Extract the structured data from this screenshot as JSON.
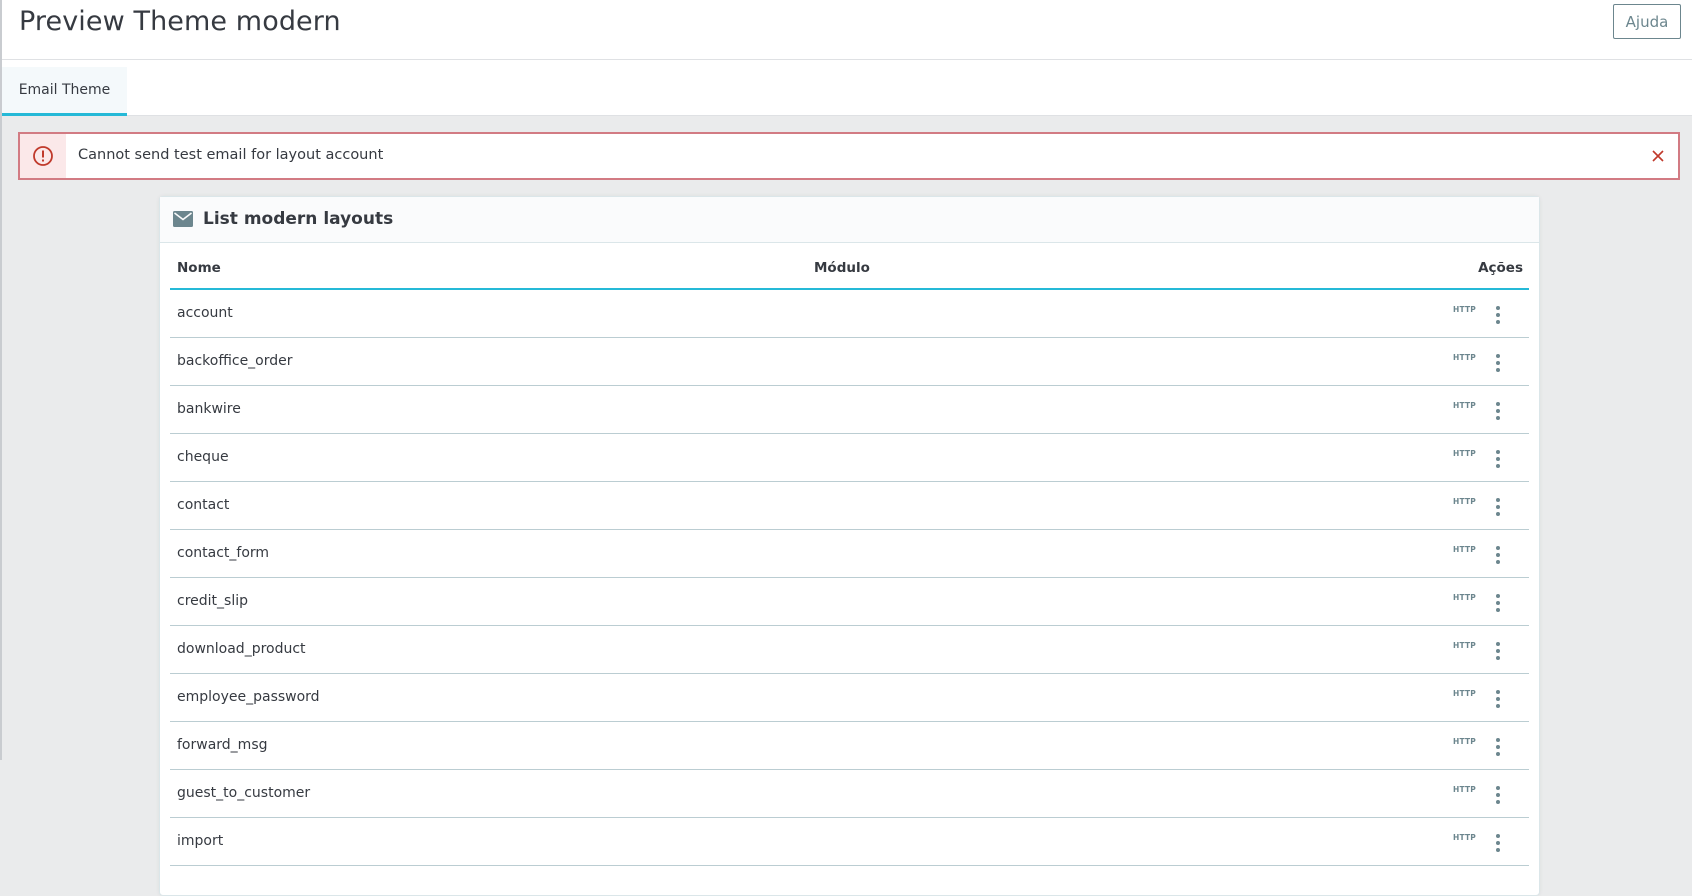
{
  "header": {
    "title": "Preview Theme modern",
    "help_label": "Ajuda"
  },
  "tabs": [
    {
      "label": "Email Theme",
      "active": true
    }
  ],
  "alert": {
    "message": "Cannot send test email for layout account",
    "icon": "error-circle-icon",
    "close_icon": "close-icon",
    "color": "#d27b83"
  },
  "card": {
    "icon": "envelope-icon",
    "title": "List modern layouts",
    "columns": {
      "name": "Nome",
      "module": "Módulo",
      "actions": "Ações"
    },
    "rows": [
      {
        "name": "account",
        "module": "",
        "action_badge": "HTTP"
      },
      {
        "name": "backoffice_order",
        "module": "",
        "action_badge": "HTTP"
      },
      {
        "name": "bankwire",
        "module": "",
        "action_badge": "HTTP"
      },
      {
        "name": "cheque",
        "module": "",
        "action_badge": "HTTP"
      },
      {
        "name": "contact",
        "module": "",
        "action_badge": "HTTP"
      },
      {
        "name": "contact_form",
        "module": "",
        "action_badge": "HTTP"
      },
      {
        "name": "credit_slip",
        "module": "",
        "action_badge": "HTTP"
      },
      {
        "name": "download_product",
        "module": "",
        "action_badge": "HTTP"
      },
      {
        "name": "employee_password",
        "module": "",
        "action_badge": "HTTP"
      },
      {
        "name": "forward_msg",
        "module": "",
        "action_badge": "HTTP"
      },
      {
        "name": "guest_to_customer",
        "module": "",
        "action_badge": "HTTP"
      },
      {
        "name": "import",
        "module": "",
        "action_badge": "HTTP"
      }
    ]
  },
  "colors": {
    "accent": "#25b9d7",
    "icon_grey": "#6c868e",
    "background": "#eaebec"
  }
}
